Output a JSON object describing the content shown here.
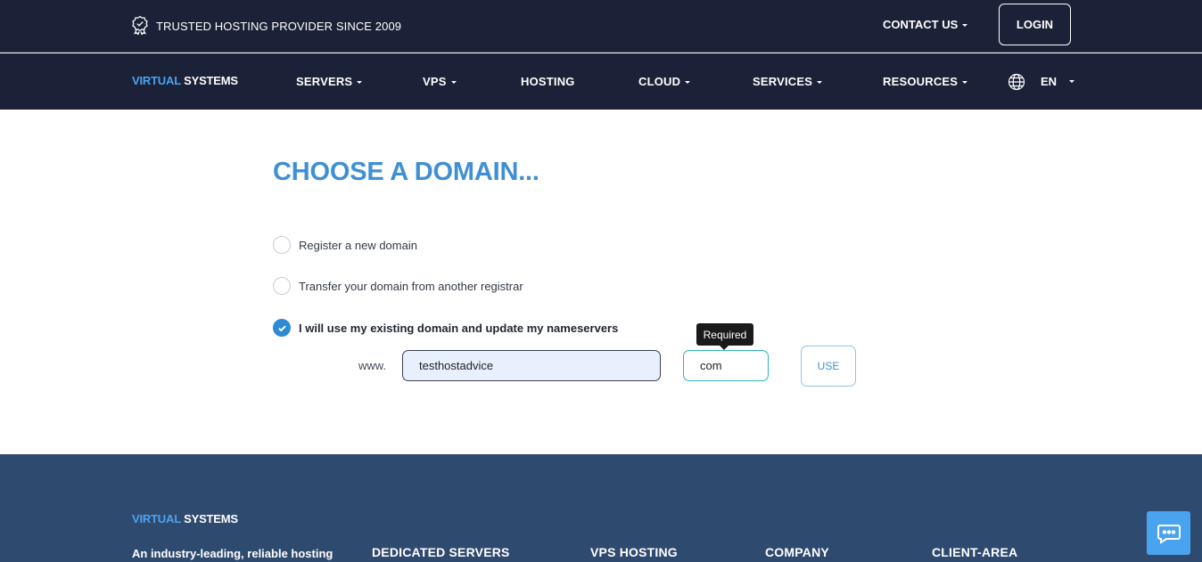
{
  "topbar": {
    "trust_text": "TRUSTED HOSTING PROVIDER SINCE 2009",
    "contact_label": "CONTACT US",
    "login_label": "LOGIN"
  },
  "brand": {
    "part1": "VIRTUAL",
    "part2": "SYSTEMS"
  },
  "nav": {
    "items": [
      {
        "label": "SERVERS",
        "dropdown": true
      },
      {
        "label": "VPS",
        "dropdown": true
      },
      {
        "label": "HOSTING",
        "dropdown": false
      },
      {
        "label": "CLOUD",
        "dropdown": true
      },
      {
        "label": "SERVICES",
        "dropdown": true
      },
      {
        "label": "RESOURCES",
        "dropdown": true
      }
    ],
    "language": "EN"
  },
  "main": {
    "heading": "CHOOSE A DOMAIN...",
    "options": [
      {
        "label": "Register a new domain",
        "checked": false
      },
      {
        "label": "Transfer your domain from another registrar",
        "checked": false
      },
      {
        "label": "I will use my existing domain and update my nameservers",
        "checked": true
      }
    ],
    "www_prefix": "www.",
    "domain_value": "testhostadvice",
    "tld_value": "com",
    "tooltip": "Required",
    "use_label": "USE"
  },
  "footer": {
    "tagline": "An industry-leading, reliable hosting",
    "columns": [
      "DEDICATED SERVERS",
      "VPS HOSTING",
      "COMPANY",
      "CLIENT-AREA"
    ]
  },
  "colors": {
    "header_bg": "#1b2136",
    "accent": "#3f8fd4",
    "footer_bg": "#2f4a6f",
    "chat_button": "#4aa3ef"
  },
  "icons": [
    "badge-check-icon",
    "globe-icon",
    "check-icon",
    "chat-icon"
  ]
}
